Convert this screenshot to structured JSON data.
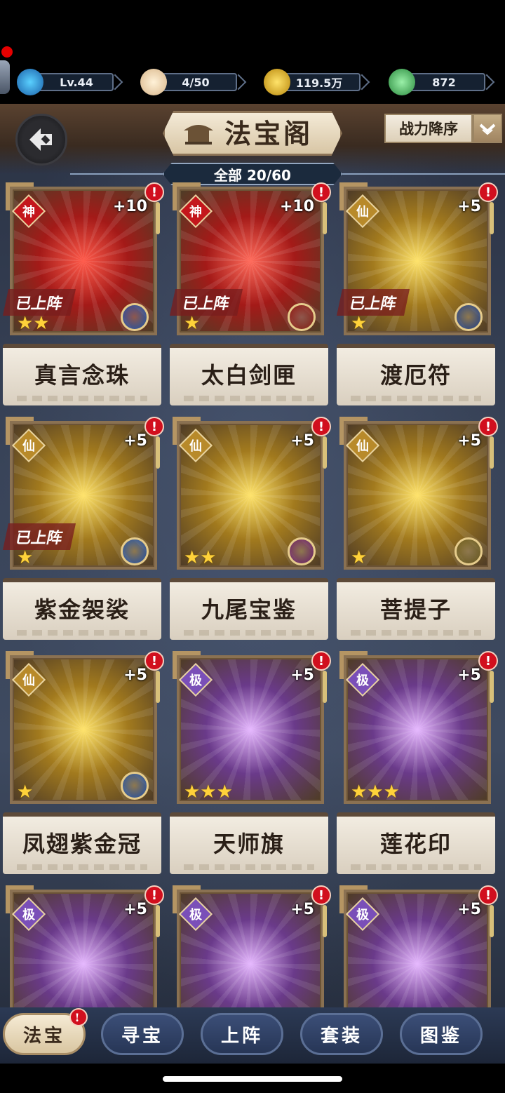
{
  "resources": {
    "level": "Lv.44",
    "stamina": "4/50",
    "coins": "119.5万",
    "jade": "872"
  },
  "header": {
    "title": "法宝阁",
    "sort_label": "战力降序",
    "filter_label": "全部 20/60"
  },
  "colors": {
    "shen": "#c4161c",
    "xian": "#b88a2a",
    "ji": "#7a4fb8"
  },
  "cards": [
    {
      "name": "真言念珠",
      "rank": "神",
      "rank_color": "#c4161c",
      "level": "+10",
      "deployed": "已上阵",
      "stars": "★★",
      "element": "water-icon",
      "elem_color": "#1d4fa8",
      "glow1": "#ff5a4a",
      "glow2": "#a41a18",
      "alert": "!"
    },
    {
      "name": "太白剑匣",
      "rank": "神",
      "rank_color": "#c4161c",
      "level": "+10",
      "deployed": "已上阵",
      "stars": "★",
      "element": "fire-icon",
      "elem_color": "#8a1a12",
      "glow1": "#ff6a5a",
      "glow2": "#a41a18",
      "alert": "!"
    },
    {
      "name": "渡厄符",
      "rank": "仙",
      "rank_color": "#b88a2a",
      "level": "+5",
      "deployed": "已上阵",
      "stars": "★",
      "element": "wind-icon",
      "elem_color": "#1d3f8a",
      "glow1": "#ffe36a",
      "glow2": "#a27a1e",
      "alert": "!"
    },
    {
      "name": "紫金袈裟",
      "rank": "仙",
      "rank_color": "#b88a2a",
      "level": "+5",
      "deployed": "已上阵",
      "stars": "★",
      "element": "water-icon",
      "elem_color": "#1d4fa8",
      "glow1": "#ffe36a",
      "glow2": "#a27a1e",
      "alert": "!"
    },
    {
      "name": "九尾宝鉴",
      "rank": "仙",
      "rank_color": "#b88a2a",
      "level": "+5",
      "deployed": "",
      "stars": "★★",
      "element": "shadow-icon",
      "elem_color": "#6a1a6a",
      "glow1": "#ffe36a",
      "glow2": "#a27a1e",
      "alert": "!"
    },
    {
      "name": "菩提子",
      "rank": "仙",
      "rank_color": "#b88a2a",
      "level": "+5",
      "deployed": "",
      "stars": "★",
      "element": "thunder-icon",
      "elem_color": "#6a5a1a",
      "glow1": "#ffe36a",
      "glow2": "#a27a1e",
      "alert": "!"
    },
    {
      "name": "凤翅紫金冠",
      "rank": "仙",
      "rank_color": "#b88a2a",
      "level": "+5",
      "deployed": "",
      "stars": "★",
      "element": "vortex-icon",
      "elem_color": "#1d4fa8",
      "glow1": "#ffe36a",
      "glow2": "#a27a1e",
      "alert": "!"
    },
    {
      "name": "天师旗",
      "rank": "极",
      "rank_color": "#7a4fb8",
      "level": "+5",
      "deployed": "",
      "stars": "★★★",
      "element": "",
      "elem_color": "",
      "glow1": "#e6b8ff",
      "glow2": "#6a3a8a",
      "alert": "!"
    },
    {
      "name": "莲花印",
      "rank": "极",
      "rank_color": "#7a4fb8",
      "level": "+5",
      "deployed": "",
      "stars": "★★★",
      "element": "",
      "elem_color": "",
      "glow1": "#e6b8ff",
      "glow2": "#6a3a8a",
      "alert": "!"
    },
    {
      "name": "",
      "rank": "极",
      "rank_color": "#7a4fb8",
      "level": "+5",
      "deployed": "",
      "stars": "",
      "element": "",
      "elem_color": "",
      "glow1": "#e6b8ff",
      "glow2": "#6a3a8a",
      "alert": "!"
    },
    {
      "name": "",
      "rank": "极",
      "rank_color": "#7a4fb8",
      "level": "+5",
      "deployed": "",
      "stars": "",
      "element": "",
      "elem_color": "",
      "glow1": "#e6b8ff",
      "glow2": "#6a3a8a",
      "alert": "!"
    },
    {
      "name": "",
      "rank": "极",
      "rank_color": "#7a4fb8",
      "level": "+5",
      "deployed": "",
      "stars": "",
      "element": "",
      "elem_color": "",
      "glow1": "#e6b8ff",
      "glow2": "#6a3a8a",
      "alert": "!"
    }
  ],
  "nav": {
    "tabs": [
      "法宝",
      "寻宝",
      "上阵",
      "套装",
      "图鉴"
    ],
    "active": 0,
    "badge": "!"
  }
}
